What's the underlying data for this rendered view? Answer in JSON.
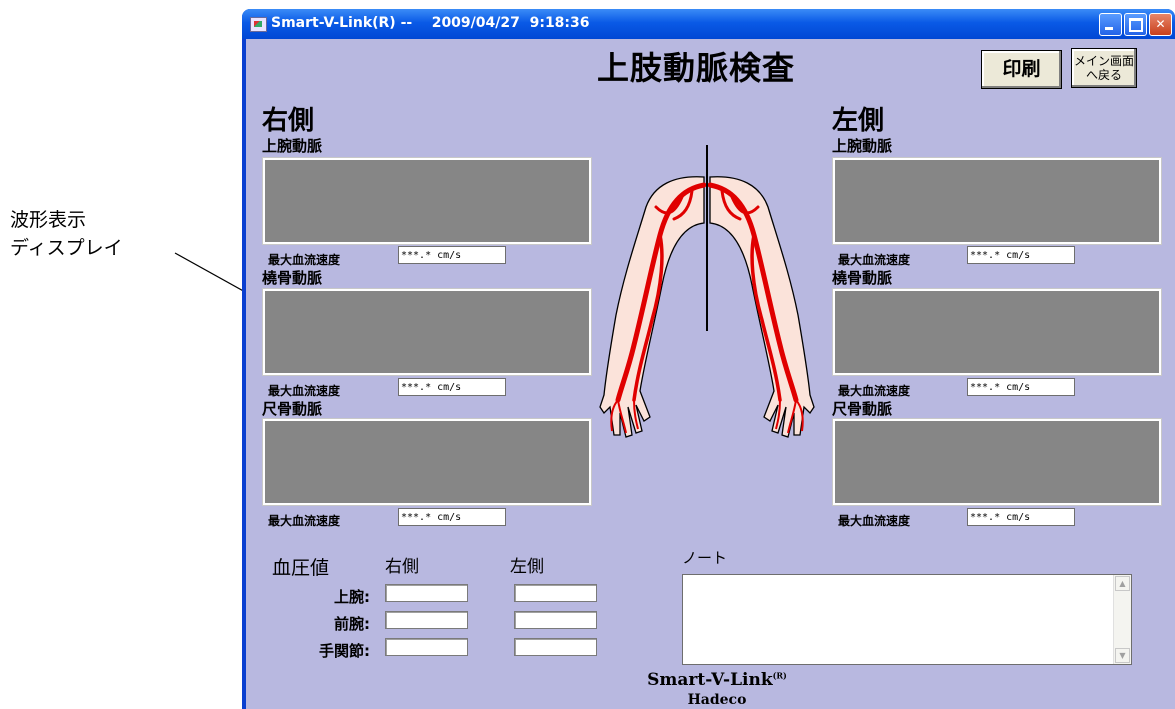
{
  "annotation": {
    "line1": "波形表示",
    "line2": "ディスプレイ"
  },
  "window": {
    "title": "Smart-V-Link(R) --    2009/04/27  9:18:36"
  },
  "header": {
    "title": "上肢動脈検査",
    "print_label": "印刷",
    "back_line1": "メイン画面",
    "back_line2": "へ戻る"
  },
  "right_side": {
    "heading": "右側",
    "panels": [
      {
        "label": "上腕動脈",
        "velocity_label": "最大血流速度",
        "velocity_value": "***.* cm/s"
      },
      {
        "label": "橈骨動脈",
        "velocity_label": "最大血流速度",
        "velocity_value": "***.* cm/s"
      },
      {
        "label": "尺骨動脈",
        "velocity_label": "最大血流速度",
        "velocity_value": "***.* cm/s"
      }
    ]
  },
  "left_side": {
    "heading": "左側",
    "panels": [
      {
        "label": "上腕動脈",
        "velocity_label": "最大血流速度",
        "velocity_value": "***.* cm/s"
      },
      {
        "label": "橈骨動脈",
        "velocity_label": "最大血流速度",
        "velocity_value": "***.* cm/s"
      },
      {
        "label": "尺骨動脈",
        "velocity_label": "最大血流速度",
        "velocity_value": "***.* cm/s"
      }
    ]
  },
  "blood_pressure": {
    "title": "血圧値",
    "col_right": "右側",
    "col_left": "左側",
    "rows": [
      {
        "label": "上腕:",
        "right": "",
        "left": ""
      },
      {
        "label": "前腕:",
        "right": "",
        "left": ""
      },
      {
        "label": "手関節:",
        "right": "",
        "left": ""
      }
    ]
  },
  "note": {
    "label": "ノート",
    "value": ""
  },
  "brand": {
    "name": "Smart-V-Link",
    "mark": "(R)",
    "company": "Hadeco"
  },
  "colors": {
    "client_bg": "#b8b8e0",
    "wave_bg": "#868686",
    "artery": "#e00000",
    "skin": "#fbe3da"
  }
}
